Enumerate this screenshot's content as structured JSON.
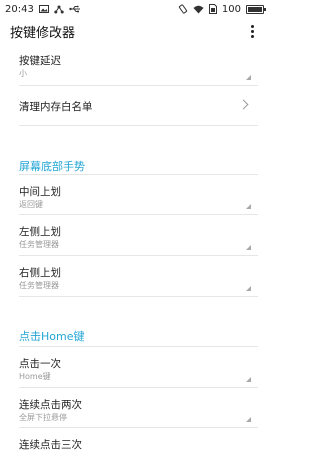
{
  "status": {
    "time": "20:43",
    "battery": "100"
  },
  "appbar": {
    "title": "按键修改器"
  },
  "items": [
    {
      "title": "按键延迟",
      "sub": "小"
    },
    {
      "title": "清理内存白名单"
    }
  ],
  "section_bottom_gesture": {
    "header": "屏幕底部手势",
    "items": [
      {
        "title": "中间上划",
        "sub": "返回键"
      },
      {
        "title": "左侧上划",
        "sub": "任务管理器"
      },
      {
        "title": "右侧上划",
        "sub": "任务管理器"
      }
    ]
  },
  "section_home": {
    "header": "点击Home键",
    "items": [
      {
        "title": "点击一次",
        "sub": "Home键"
      },
      {
        "title": "连续点击两次",
        "sub": "全屏下拉悬停"
      },
      {
        "title": "连续点击三次"
      }
    ]
  },
  "colors": {
    "accent": "#23a6d5"
  }
}
